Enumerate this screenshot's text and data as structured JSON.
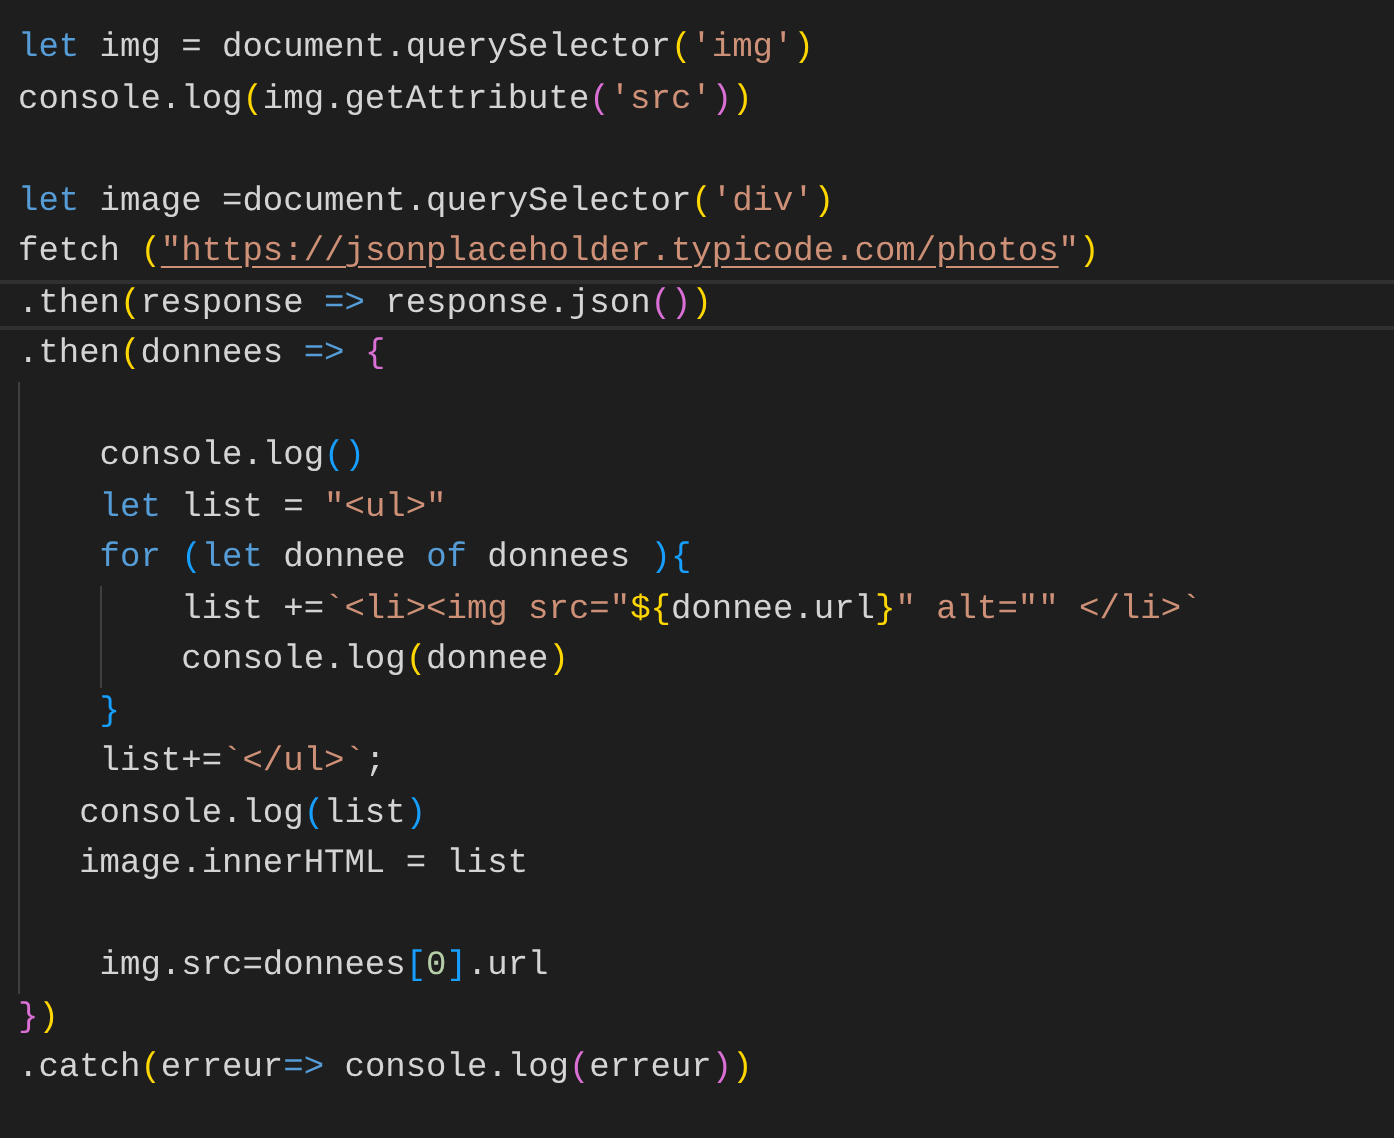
{
  "editor": {
    "lines": [
      {
        "selected": false,
        "tokens": [
          {
            "kind": "keyword",
            "text": "let"
          },
          {
            "kind": "plain",
            "text": " img = document.querySelector"
          },
          {
            "kind": "bracket1",
            "text": "("
          },
          {
            "kind": "string",
            "text": "'img'"
          },
          {
            "kind": "bracket1",
            "text": ")"
          }
        ]
      },
      {
        "selected": false,
        "tokens": [
          {
            "kind": "plain",
            "text": "console.log"
          },
          {
            "kind": "bracket1",
            "text": "("
          },
          {
            "kind": "plain",
            "text": "img.getAttribute"
          },
          {
            "kind": "bracket2",
            "text": "("
          },
          {
            "kind": "string",
            "text": "'src'"
          },
          {
            "kind": "bracket2",
            "text": ")"
          },
          {
            "kind": "bracket1",
            "text": ")"
          }
        ]
      },
      {
        "selected": false
      },
      {
        "selected": false,
        "tokens": [
          {
            "kind": "keyword",
            "text": "let"
          },
          {
            "kind": "plain",
            "text": " image =document.querySelector"
          },
          {
            "kind": "bracket1",
            "text": "("
          },
          {
            "kind": "string",
            "text": "'div'"
          },
          {
            "kind": "bracket1",
            "text": ")"
          }
        ]
      },
      {
        "selected": false,
        "tokens": [
          {
            "kind": "plain",
            "text": "fetch "
          },
          {
            "kind": "bracket1",
            "text": "("
          },
          {
            "kind": "link",
            "text": "\"https://jsonplaceholder.typicode.com/photos"
          },
          {
            "kind": "string",
            "text": "\""
          },
          {
            "kind": "bracket1",
            "text": ")"
          }
        ]
      },
      {
        "selected": true,
        "tokens": [
          {
            "kind": "plain",
            "text": ".then"
          },
          {
            "kind": "bracket1",
            "text": "("
          },
          {
            "kind": "plain",
            "text": "response "
          },
          {
            "kind": "keyword",
            "text": "=>"
          },
          {
            "kind": "plain",
            "text": " response.json"
          },
          {
            "kind": "bracket2",
            "text": "("
          },
          {
            "kind": "bracket2",
            "text": ")"
          },
          {
            "kind": "bracket1",
            "text": ")"
          }
        ]
      },
      {
        "selected": false,
        "tokens": [
          {
            "kind": "plain",
            "text": ".then"
          },
          {
            "kind": "bracket1",
            "text": "("
          },
          {
            "kind": "plain",
            "text": "donnees "
          },
          {
            "kind": "keyword",
            "text": "=> "
          },
          {
            "kind": "bracket2",
            "text": "{"
          }
        ]
      },
      {
        "selected": false
      },
      {
        "selected": false,
        "tokens": [
          {
            "kind": "plain",
            "text": "    console.log"
          },
          {
            "kind": "bracket3",
            "text": "()"
          }
        ]
      },
      {
        "selected": false,
        "tokens": [
          {
            "kind": "keyword",
            "text": "    let"
          },
          {
            "kind": "plain",
            "text": " list = "
          },
          {
            "kind": "string",
            "text": "\"<ul>\""
          }
        ]
      },
      {
        "selected": false,
        "tokens": [
          {
            "kind": "keyword",
            "text": "    for "
          },
          {
            "kind": "bracket3",
            "text": "("
          },
          {
            "kind": "keyword",
            "text": "let"
          },
          {
            "kind": "plain",
            "text": " donnee "
          },
          {
            "kind": "keyword",
            "text": "of"
          },
          {
            "kind": "plain",
            "text": " donnees "
          },
          {
            "kind": "bracket3",
            "text": "){"
          }
        ]
      },
      {
        "selected": false,
        "tokens": [
          {
            "kind": "plain",
            "text": "        list +="
          },
          {
            "kind": "string",
            "text": "`<li><img src=\""
          },
          {
            "kind": "bracket1",
            "text": "${"
          },
          {
            "kind": "plain",
            "text": "donnee.url"
          },
          {
            "kind": "bracket1",
            "text": "}"
          },
          {
            "kind": "string",
            "text": "\" alt=\"\" </li>`"
          }
        ]
      },
      {
        "selected": false,
        "tokens": [
          {
            "kind": "plain",
            "text": "        console.log"
          },
          {
            "kind": "bracket1",
            "text": "("
          },
          {
            "kind": "plain",
            "text": "donnee"
          },
          {
            "kind": "bracket1",
            "text": ")"
          }
        ]
      },
      {
        "selected": false,
        "tokens": [
          {
            "kind": "bracket3",
            "text": "    }"
          }
        ]
      },
      {
        "selected": false,
        "tokens": [
          {
            "kind": "plain",
            "text": "    list+="
          },
          {
            "kind": "string",
            "text": "`</ul>`"
          },
          {
            "kind": "plain",
            "text": ";"
          }
        ]
      },
      {
        "selected": false,
        "tokens": [
          {
            "kind": "plain",
            "text": "   console.log"
          },
          {
            "kind": "bracket3",
            "text": "("
          },
          {
            "kind": "plain",
            "text": "list"
          },
          {
            "kind": "bracket3",
            "text": ")"
          }
        ]
      },
      {
        "selected": false,
        "tokens": [
          {
            "kind": "plain",
            "text": "   image.innerHTML = list"
          }
        ]
      },
      {
        "selected": false
      },
      {
        "selected": false,
        "tokens": [
          {
            "kind": "plain",
            "text": "    img.src=donnees"
          },
          {
            "kind": "bracket3",
            "text": "["
          },
          {
            "kind": "number",
            "text": "0"
          },
          {
            "kind": "bracket3",
            "text": "]"
          },
          {
            "kind": "plain",
            "text": ".url"
          }
        ]
      },
      {
        "selected": false,
        "tokens": [
          {
            "kind": "bracket2",
            "text": "}"
          },
          {
            "kind": "bracket1",
            "text": ")"
          }
        ]
      },
      {
        "selected": false,
        "tokens": [
          {
            "kind": "plain",
            "text": ".catch"
          },
          {
            "kind": "bracket1",
            "text": "("
          },
          {
            "kind": "plain",
            "text": "erreur"
          },
          {
            "kind": "keyword",
            "text": "=>"
          },
          {
            "kind": "plain",
            "text": " console.log"
          },
          {
            "kind": "bracket2",
            "text": "("
          },
          {
            "kind": "plain",
            "text": "erreur"
          },
          {
            "kind": "bracket2",
            "text": ")"
          },
          {
            "kind": "bracket1",
            "text": ")"
          }
        ]
      }
    ]
  }
}
